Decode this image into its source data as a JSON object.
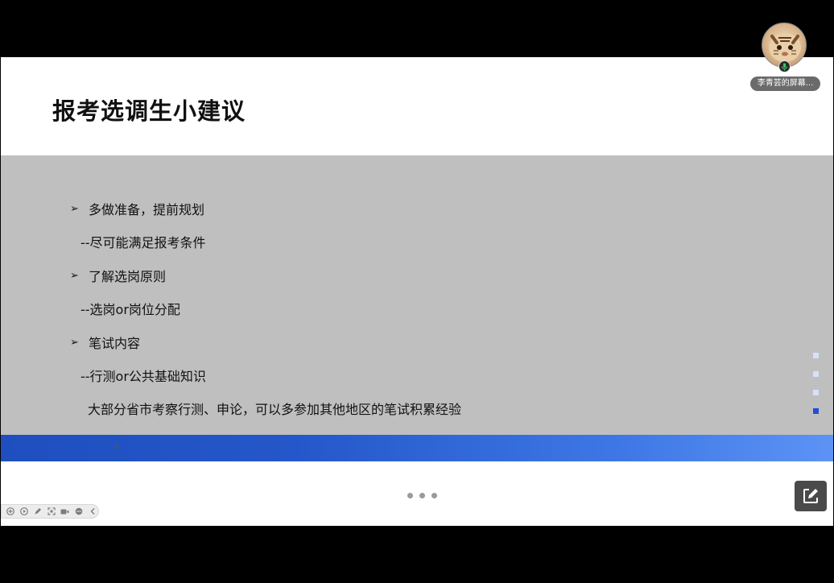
{
  "slide": {
    "title": "报考选调生小建议",
    "bullets": [
      {
        "marker": "➢",
        "text": "多做准备，提前规划"
      },
      {
        "text": "--尽可能满足报考条件"
      },
      {
        "marker": "➢",
        "text": "了解选岗原则"
      },
      {
        "text": "--选岗or岗位分配"
      },
      {
        "marker": "➢",
        "text": "笔试内容"
      },
      {
        "text": "--行测or公共基础知识"
      },
      {
        "text": "大部分省市考察行测、申论，可以多参加其他地区的笔试积累经验"
      }
    ],
    "colors": {
      "gray_band": "#bfbfbf",
      "blue_band": "#2457c9",
      "page_indicator_active": "#1f4fd8"
    }
  },
  "page_indicator": {
    "count": 4,
    "active_index": 3
  },
  "participant": {
    "name": "李青芸的屏幕...",
    "mic_icon": "mic-icon"
  },
  "toolbar": {
    "icons": [
      "add-icon",
      "play-icon",
      "pen-icon",
      "fullscreen-icon",
      "camera-icon",
      "more-icon",
      "collapse-icon"
    ]
  },
  "more_menu_icon": "ellipsis-icon",
  "edit_button_icon": "edit-icon"
}
